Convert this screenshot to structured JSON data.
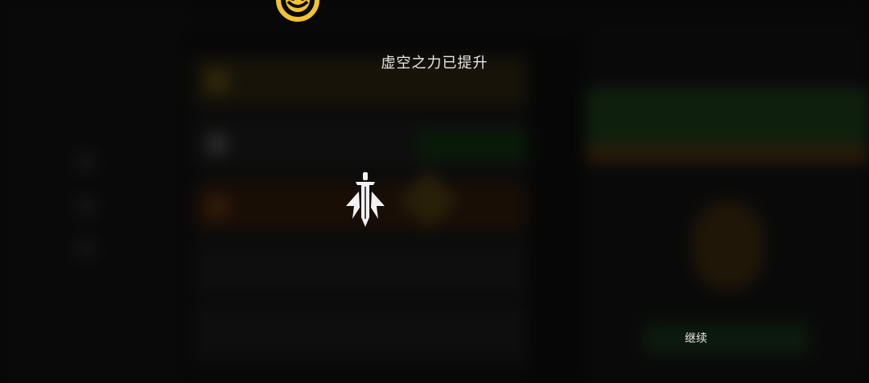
{
  "modal": {
    "title": "虚空之力已提升",
    "continue_label": "继续"
  },
  "icons": {
    "top_emblem": "void-emblem-icon",
    "center": "sword-icon"
  },
  "colors": {
    "emblem_gold": "#f2c230",
    "icon_white": "#f2f2f2",
    "text": "#e8e8e8"
  }
}
